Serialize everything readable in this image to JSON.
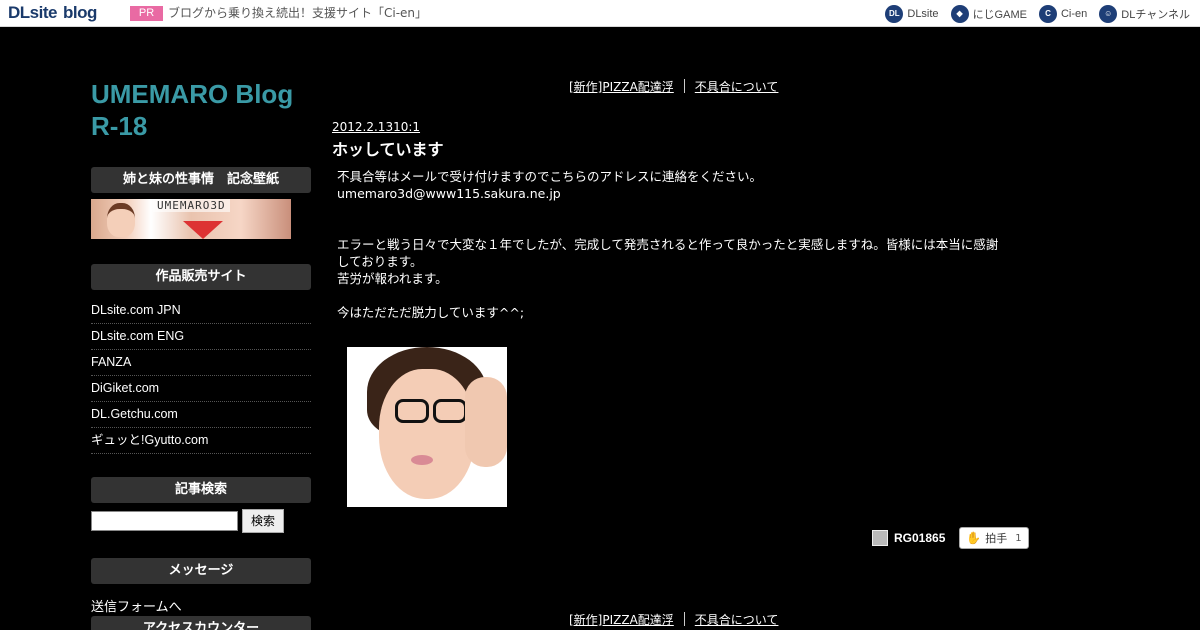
{
  "topbar": {
    "logo_main": "DLsite",
    "logo_sub": "blog",
    "pr_badge": "PR",
    "pr_text": "ブログから乗り換え続出！支援サイト「Ci-en」",
    "links": [
      {
        "label": "DLsite",
        "icon": "dlsite-icon",
        "glyph": "DL"
      },
      {
        "label": "にじGAME",
        "icon": "nijigame-icon",
        "glyph": "◆"
      },
      {
        "label": "Ci-en",
        "icon": "cien-icon",
        "glyph": "C"
      },
      {
        "label": "DLチャンネル",
        "icon": "dlchannel-icon",
        "glyph": "☺"
      }
    ]
  },
  "sidebar": {
    "blog_title": "UMEMARO Blog R-18",
    "wallpaper_heading": "姉と妹の性事情　記念壁紙",
    "wallpaper_banner_text": "UMEMARO3D",
    "sales_heading": "作品販売サイト",
    "sales_sites": [
      "DLsite.com JPN",
      "DLsite.com ENG",
      "FANZA",
      "DiGiket.com",
      "DL.Getchu.com",
      "ギュッと!Gyutto.com"
    ],
    "search_heading": "記事検索",
    "search_input_value": "",
    "search_button": "検索",
    "message_heading": "メッセージ",
    "message_link": "送信フォームへ",
    "counter_heading": "アクセスカウンター"
  },
  "post_nav": {
    "prev_label": "[新作]PIZZA配達浮",
    "next_label": "不具合について"
  },
  "post": {
    "date": "2012.2.1310:1",
    "title": "ホッしています",
    "para1_line1": "不具合等はメールで受け付けますのでこちらのアドレスに連絡をください。",
    "para1_line2": "umemaro3d@www115.sakura.ne.jp",
    "para2_line1": "エラーと戦う日々で大変な１年でしたが、完成して発売されると作って良かったと実感しますね。皆様には本当に感謝",
    "para2_line2": "しております。",
    "para2_line3": "苦労が報われます。",
    "para3": "今はただただ脱力しています^^;",
    "author": "RG01865",
    "clap_label": "拍手",
    "clap_count": "1"
  },
  "colors": {
    "background": "#000000",
    "title_teal": "#3a9aa6",
    "side_heading_bg": "#333333",
    "pr_pink": "#e96aa3",
    "brand_navy": "#1a3a6b"
  }
}
